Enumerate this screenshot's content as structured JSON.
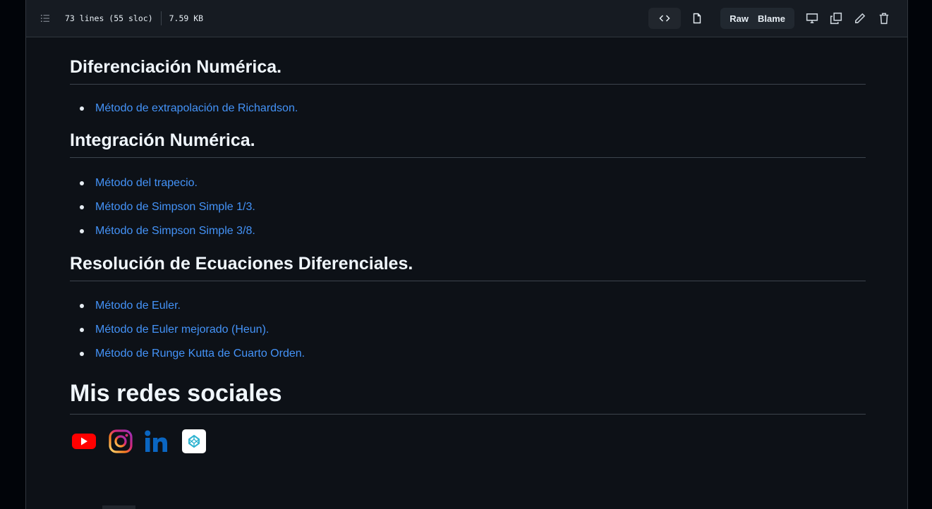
{
  "header": {
    "lines": "73 lines (55 sloc)",
    "size": "7.59 KB",
    "raw_label": "Raw",
    "blame_label": "Blame"
  },
  "sections": [
    {
      "title": "Diferenciación Numérica.",
      "items": [
        "Método de extrapolación de Richardson."
      ]
    },
    {
      "title": "Integración Numérica.",
      "items": [
        "Método del trapecio.",
        "Método de Simpson Simple 1/3.",
        "Método de Simpson Simple 3/8."
      ]
    },
    {
      "title": "Resolución de Ecuaciones Diferenciales.",
      "items": [
        "Método de Euler.",
        "Método de Euler mejorado (Heun).",
        "Método de Runge Kutta de Cuarto Orden."
      ]
    }
  ],
  "social": {
    "title": "Mis redes sociales",
    "icons": [
      "youtube-icon",
      "instagram-icon",
      "linkedin-icon",
      "codepen-icon"
    ]
  },
  "colors": {
    "link": "#4493f8",
    "background": "#0d1117"
  }
}
